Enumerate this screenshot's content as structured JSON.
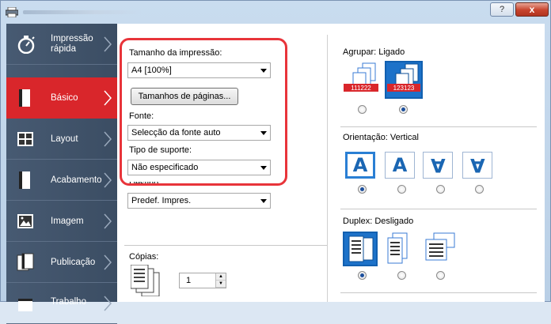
{
  "window": {
    "help_label": "?",
    "close_label": "x"
  },
  "sidebar": {
    "items": [
      {
        "label": "Impressão rápida",
        "line1": "Impressão",
        "line2": "rápida"
      },
      {
        "label": "Básico"
      },
      {
        "label": "Layout"
      },
      {
        "label": "Acabamento"
      },
      {
        "label": "Imagem"
      },
      {
        "label": "Publicação"
      },
      {
        "label": "Trabalho"
      }
    ]
  },
  "basic": {
    "print_size_label": "Tamanho da impressão:",
    "print_size_value": "A4  [100%]",
    "page_sizes_button": "Tamanhos de páginas...",
    "source_label": "Fonte:",
    "source_value": "Selecção da fonte auto",
    "media_type_label": "Tipo de suporte:",
    "media_type_value": "Não especificado",
    "destination_label": "Destino:",
    "destination_value": "Predef. Impres.",
    "copies_label": "Cópias:",
    "copies_value": "1"
  },
  "right": {
    "collate_label": "Agrupar: Ligado",
    "collate_options": [
      "off",
      "on"
    ],
    "collate_selected": 1,
    "collate_icon_text_1": "111222",
    "collate_icon_text_2": "123123",
    "orientation_label": "Orientação: Vertical",
    "orientation_glyph": "A",
    "orientation_selected": 0,
    "duplex_label": "Duplex: Desligado",
    "duplex_selected": 0
  },
  "colors": {
    "sidebar_bg": "#475a72",
    "active_bg": "#d9262b",
    "highlight": "#e8343a",
    "accent_blue": "#1a66b3"
  }
}
